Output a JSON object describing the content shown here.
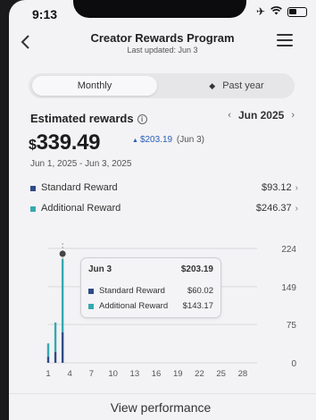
{
  "status": {
    "time": "9:13"
  },
  "header": {
    "title": "Creator Rewards Program",
    "subtitle": "Last updated: Jun 3"
  },
  "tabs": [
    {
      "label": "Monthly",
      "active": true
    },
    {
      "label": "Past year",
      "active": false
    }
  ],
  "summary": {
    "label": "Estimated rewards",
    "month": "Jun 2025",
    "amount_symbol": "$",
    "amount": "339.49",
    "delta": "$203.19",
    "delta_date": "(Jun 3)",
    "range": "Jun 1, 2025 - Jun 3, 2025"
  },
  "breakdown": [
    {
      "label": "Standard Reward",
      "value": "$93.12",
      "color": "#2f4a86"
    },
    {
      "label": "Additional Reward",
      "value": "$246.37",
      "color": "#35a9b0"
    }
  ],
  "tooltip": {
    "date": "Jun 3",
    "total": "$203.19",
    "rows": [
      {
        "label": "Standard Reward",
        "value": "$60.02"
      },
      {
        "label": "Additional Reward",
        "value": "$143.17"
      }
    ]
  },
  "chart_data": {
    "type": "bar",
    "stacked": true,
    "categories": [
      "1",
      "2",
      "3"
    ],
    "series": [
      {
        "name": "Standard Reward",
        "values": [
          12,
          21,
          60.02
        ],
        "color": "#2f4a86"
      },
      {
        "name": "Additional Reward",
        "values": [
          26,
          58,
          143.17
        ],
        "color": "#35a9b0"
      }
    ],
    "x_ticks": [
      "1",
      "4",
      "7",
      "10",
      "13",
      "16",
      "19",
      "22",
      "25",
      "28"
    ],
    "y_ticks": [
      "0",
      "75",
      "149",
      "224"
    ],
    "ylim": [
      0,
      224
    ],
    "xlim": [
      1,
      30
    ],
    "selected_category": "3",
    "grid": true
  },
  "cta": {
    "label": "View performance"
  }
}
